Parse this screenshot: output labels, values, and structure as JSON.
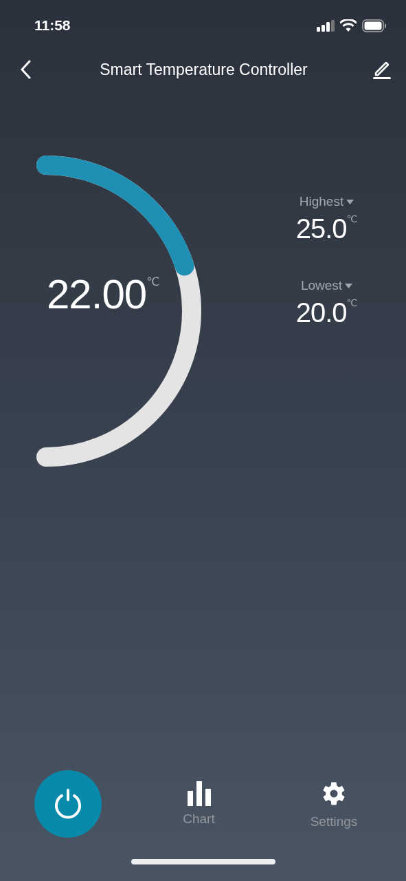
{
  "status_bar": {
    "time": "11:58"
  },
  "nav": {
    "title": "Smart Temperature Controller"
  },
  "dial": {
    "reading": "22.00",
    "unit": "℃"
  },
  "limits": [
    {
      "label": "Highest",
      "value": "25.0",
      "unit": "℃"
    },
    {
      "label": "Lowest",
      "value": "20.0",
      "unit": "℃"
    }
  ],
  "power": {
    "on": true
  },
  "tabs": [
    {
      "kind": "chart",
      "label": "Chart"
    },
    {
      "kind": "settings",
      "label": "Settings"
    }
  ]
}
